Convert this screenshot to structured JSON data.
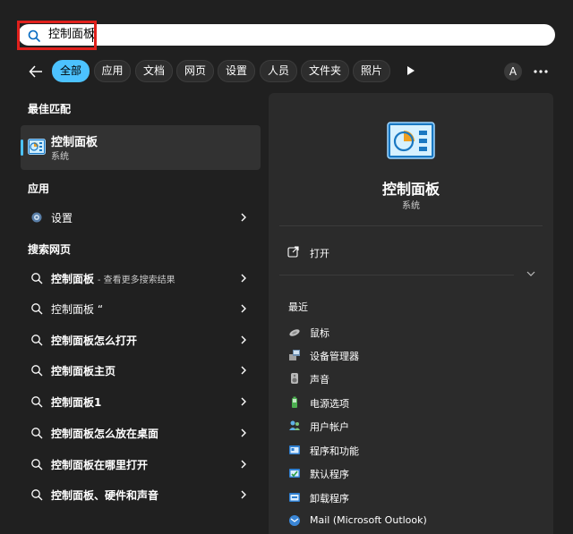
{
  "search": {
    "query": "控制面板"
  },
  "filters": {
    "items": [
      "全部",
      "应用",
      "文档",
      "网页",
      "设置",
      "人员",
      "文件夹",
      "照片"
    ],
    "active_index": 0
  },
  "account": {
    "initial": "A"
  },
  "left": {
    "best_match_title": "最佳匹配",
    "best_match": {
      "name": "控制面板",
      "type": "系统"
    },
    "apps_title": "应用",
    "apps": [
      {
        "name": "设置"
      }
    ],
    "web_title": "搜索网页",
    "web": [
      {
        "query": "控制面板",
        "hint": "- 查看更多搜索结果"
      },
      {
        "query": "控制面板 “",
        "hint": ""
      },
      {
        "query": "控制面板怎么打开",
        "hint": ""
      },
      {
        "query": "控制面板主页",
        "hint": ""
      },
      {
        "query": "控制面板1",
        "hint": ""
      },
      {
        "query": "控制面板怎么放在桌面",
        "hint": ""
      },
      {
        "query": "控制面板在哪里打开",
        "hint": ""
      },
      {
        "query": "控制面板、硬件和声音",
        "hint": ""
      }
    ]
  },
  "right": {
    "title": "控制面板",
    "subtitle": "系统",
    "open_label": "打开",
    "recent_title": "最近",
    "recent": [
      "鼠标",
      "设备管理器",
      "声音",
      "电源选项",
      "用户帐户",
      "程序和功能",
      "默认程序",
      "卸载程序",
      "Mail (Microsoft Outlook)"
    ]
  },
  "colors": {
    "accent": "#4cc2ff",
    "highlight_box": "#e0201c",
    "background": "#202020"
  }
}
